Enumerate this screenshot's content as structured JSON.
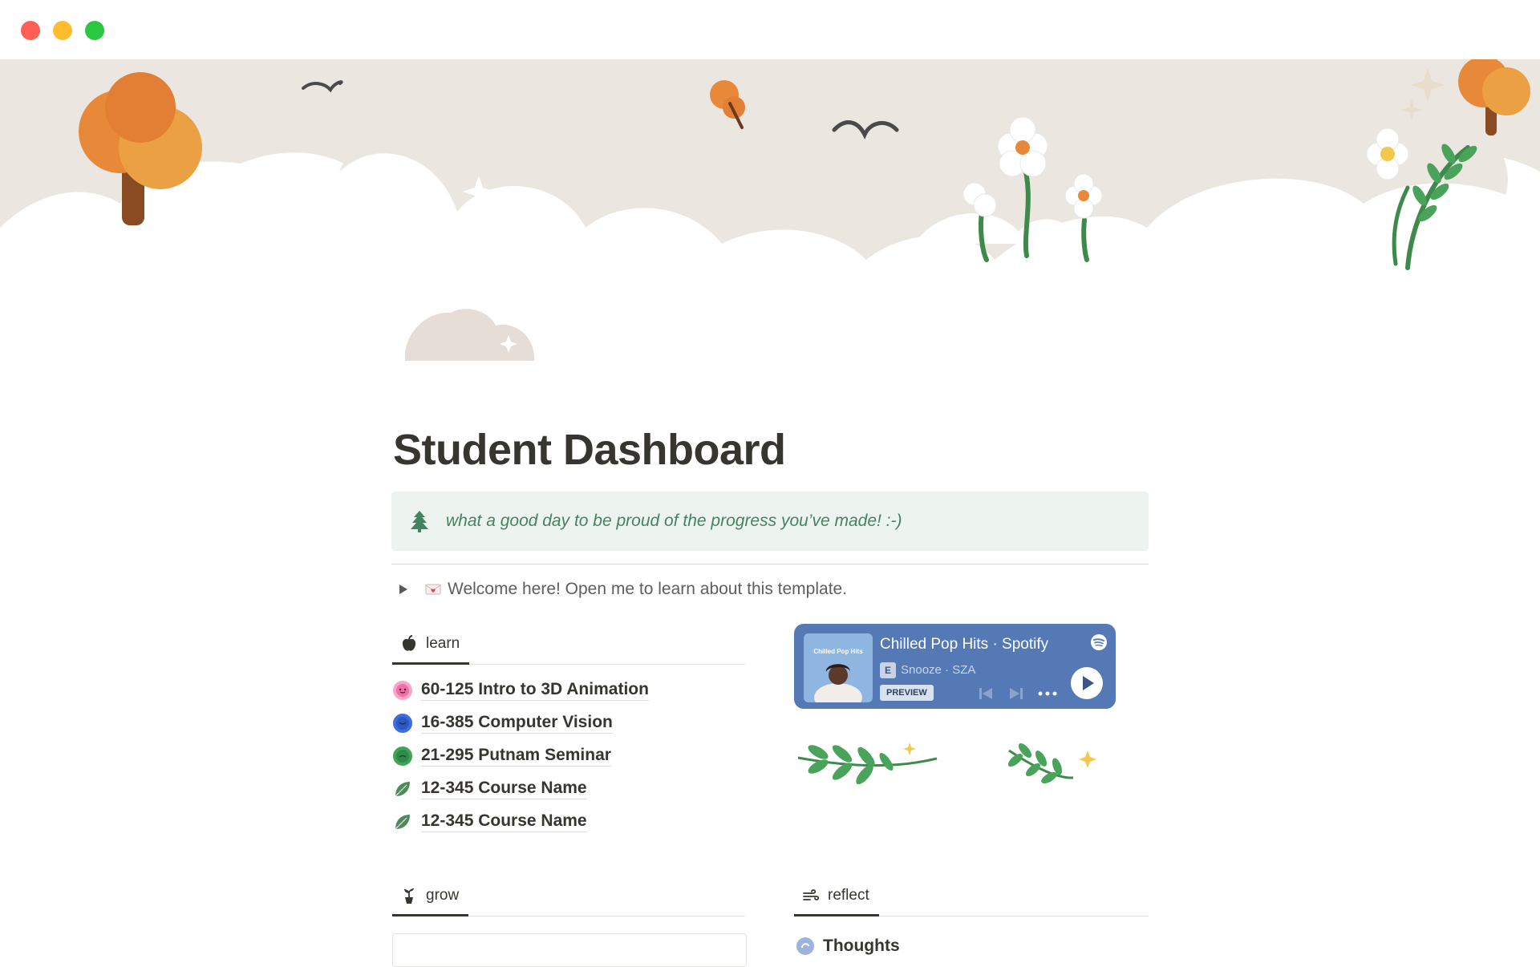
{
  "window": {
    "controls": [
      "close",
      "minimize",
      "zoom"
    ]
  },
  "page": {
    "title": "Student Dashboard",
    "callout": {
      "icon": "evergreen-tree-icon",
      "text": "what a good day to be proud of the progress you’ve made! :-)"
    },
    "toggle": {
      "icon": "love-letter-icon",
      "text": "Welcome here! Open me to learn about this template."
    }
  },
  "learn": {
    "tab": {
      "icon": "apple-icon",
      "label": "learn"
    },
    "courses": [
      {
        "icon": "pink-sun-icon",
        "label": "60-125 Intro to 3D Animation"
      },
      {
        "icon": "blue-badge-icon",
        "label": "16-385 Computer Vision"
      },
      {
        "icon": "green-badge-icon",
        "label": "21-295 Putnam Seminar"
      },
      {
        "icon": "leaf-icon",
        "label": "12-345 Course Name"
      },
      {
        "icon": "leaf-icon",
        "label": "12-345 Course Name"
      }
    ]
  },
  "player": {
    "album_label": "Chilled Pop Hits",
    "title": "Chilled Pop Hits · Spotify",
    "explicit": "E",
    "track": "Snooze · SZA",
    "preview": "PREVIEW"
  },
  "grow": {
    "tab": {
      "icon": "seedling-pot-icon",
      "label": "grow"
    }
  },
  "reflect": {
    "tab": {
      "icon": "wind-icon",
      "label": "reflect"
    },
    "first_item": "Thoughts"
  },
  "colors": {
    "callout_bg": "#edf3ee",
    "callout_text": "#448361",
    "player_bg": "#5579b5",
    "cover_hills": "#ece6e0",
    "tree_orange": "#e8893a"
  }
}
